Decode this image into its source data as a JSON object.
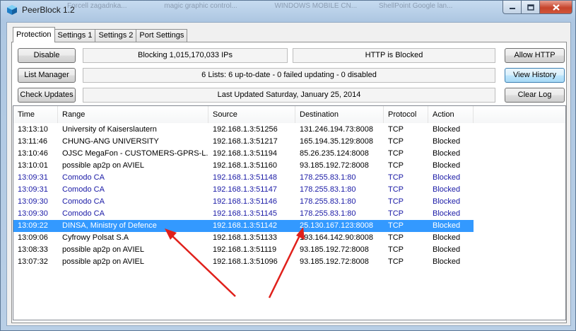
{
  "window": {
    "title": "PeerBlock 1.2",
    "background_tabs": [
      "Forcell zagadnka...",
      "magic graphic control...",
      "WINDOWS MOBILE CN...",
      "ShellPoint Google lan..."
    ]
  },
  "tabs": [
    "Protection",
    "Settings 1",
    "Settings 2",
    "Port Settings"
  ],
  "active_tab": 0,
  "buttons": {
    "disable": "Disable",
    "list_manager": "List Manager",
    "check_updates": "Check Updates",
    "allow_http": "Allow HTTP",
    "view_history": "View History",
    "clear_log": "Clear Log"
  },
  "status": {
    "blocking": "Blocking 1,015,170,033 IPs",
    "http": "HTTP is Blocked",
    "lists": "6 Lists: 6 up-to-date - 0 failed updating - 0 disabled",
    "updated": "Last Updated Saturday, January 25, 2014"
  },
  "columns": [
    "Time",
    "Range",
    "Source",
    "Destination",
    "Protocol",
    "Action"
  ],
  "rows": [
    {
      "time": "13:13:10",
      "range": "University of Kaiserslautern",
      "source": "192.168.1.3:51256",
      "destination": "131.246.194.73:8008",
      "protocol": "TCP",
      "action": "Blocked",
      "style": "normal"
    },
    {
      "time": "13:11:46",
      "range": "CHUNG-ANG UNIVERSITY",
      "source": "192.168.1.3:51217",
      "destination": "165.194.35.129:8008",
      "protocol": "TCP",
      "action": "Blocked",
      "style": "normal"
    },
    {
      "time": "13:10:46",
      "range": "OJSC MegaFon - CUSTOMERS-GPRS-L...",
      "source": "192.168.1.3:51194",
      "destination": "85.26.235.124:8008",
      "protocol": "TCP",
      "action": "Blocked",
      "style": "normal"
    },
    {
      "time": "13:10:01",
      "range": "possible ap2p on AVIEL",
      "source": "192.168.1.3:51160",
      "destination": "93.185.192.72:8008",
      "protocol": "TCP",
      "action": "Blocked",
      "style": "normal"
    },
    {
      "time": "13:09:31",
      "range": "Comodo CA",
      "source": "192.168.1.3:51148",
      "destination": "178.255.83.1:80",
      "protocol": "TCP",
      "action": "Blocked",
      "style": "blue"
    },
    {
      "time": "13:09:31",
      "range": "Comodo CA",
      "source": "192.168.1.3:51147",
      "destination": "178.255.83.1:80",
      "protocol": "TCP",
      "action": "Blocked",
      "style": "blue"
    },
    {
      "time": "13:09:30",
      "range": "Comodo CA",
      "source": "192.168.1.3:51146",
      "destination": "178.255.83.1:80",
      "protocol": "TCP",
      "action": "Blocked",
      "style": "blue"
    },
    {
      "time": "13:09:30",
      "range": "Comodo CA",
      "source": "192.168.1.3:51145",
      "destination": "178.255.83.1:80",
      "protocol": "TCP",
      "action": "Blocked",
      "style": "blue"
    },
    {
      "time": "13:09:22",
      "range": "DINSA, Ministry of Defence",
      "source": "192.168.1.3:51142",
      "destination": "25.130.167.123:8008",
      "protocol": "TCP",
      "action": "Blocked",
      "style": "selected"
    },
    {
      "time": "13:09:06",
      "range": "Cyfrowy Polsat S.A",
      "source": "192.168.1.3:51133",
      "destination": "193.164.142.90:8008",
      "protocol": "TCP",
      "action": "Blocked",
      "style": "normal"
    },
    {
      "time": "13:08:33",
      "range": "possible ap2p on AVIEL",
      "source": "192.168.1.3:51119",
      "destination": "93.185.192.72:8008",
      "protocol": "TCP",
      "action": "Blocked",
      "style": "normal"
    },
    {
      "time": "13:07:32",
      "range": "possible ap2p on AVIEL",
      "source": "192.168.1.3:51096",
      "destination": "93.185.192.72:8008",
      "protocol": "TCP",
      "action": "Blocked",
      "style": "normal"
    }
  ],
  "colors": {
    "selection": "#3399ff",
    "highlight_text": "#1a1aa6",
    "annotation_arrow": "#e0201b"
  },
  "icons": {
    "app": "peerblock-cube-icon",
    "minimize": "minimize-icon",
    "maximize": "maximize-icon",
    "close": "close-icon"
  }
}
